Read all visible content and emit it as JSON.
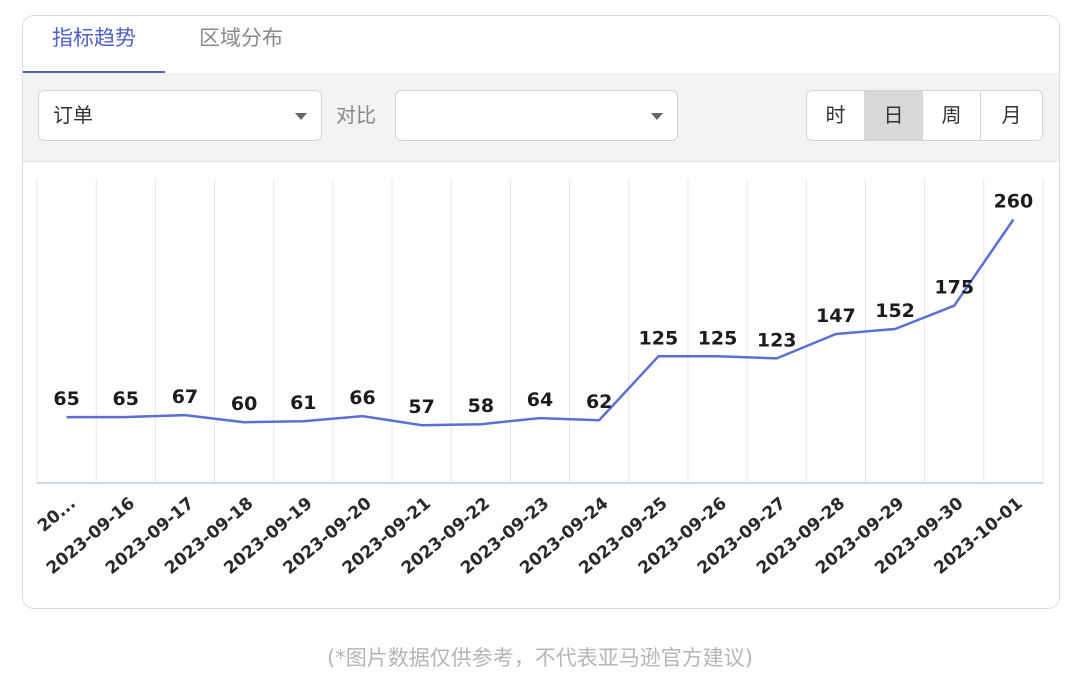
{
  "tabs": [
    {
      "label": "指标趋势",
      "active": true
    },
    {
      "label": "区域分布",
      "active": false
    }
  ],
  "toolbar": {
    "metric_select": {
      "value": "订单"
    },
    "compare_label": "对比",
    "compare_select": {
      "value": ""
    },
    "granularity": [
      {
        "label": "时",
        "selected": false
      },
      {
        "label": "日",
        "selected": true
      },
      {
        "label": "周",
        "selected": false
      },
      {
        "label": "月",
        "selected": false
      }
    ]
  },
  "chart_data": {
    "type": "line",
    "x": [
      "20...",
      "2023-09-16",
      "2023-09-17",
      "2023-09-18",
      "2023-09-19",
      "2023-09-20",
      "2023-09-21",
      "2023-09-22",
      "2023-09-23",
      "2023-09-24",
      "2023-09-25",
      "2023-09-26",
      "2023-09-27",
      "2023-09-28",
      "2023-09-29",
      "2023-09-30",
      "2023-10-01"
    ],
    "series": [
      {
        "values": [
          65,
          65,
          67,
          60,
          61,
          66,
          57,
          58,
          64,
          62,
          125,
          125,
          123,
          147,
          152,
          175,
          260
        ]
      }
    ],
    "ylim": [
      0,
      300
    ],
    "grid": "vertical",
    "line_color": "#5b6fd6"
  },
  "disclaimer": "(*图片数据仅供参考，不代表亚马逊官方建议)"
}
